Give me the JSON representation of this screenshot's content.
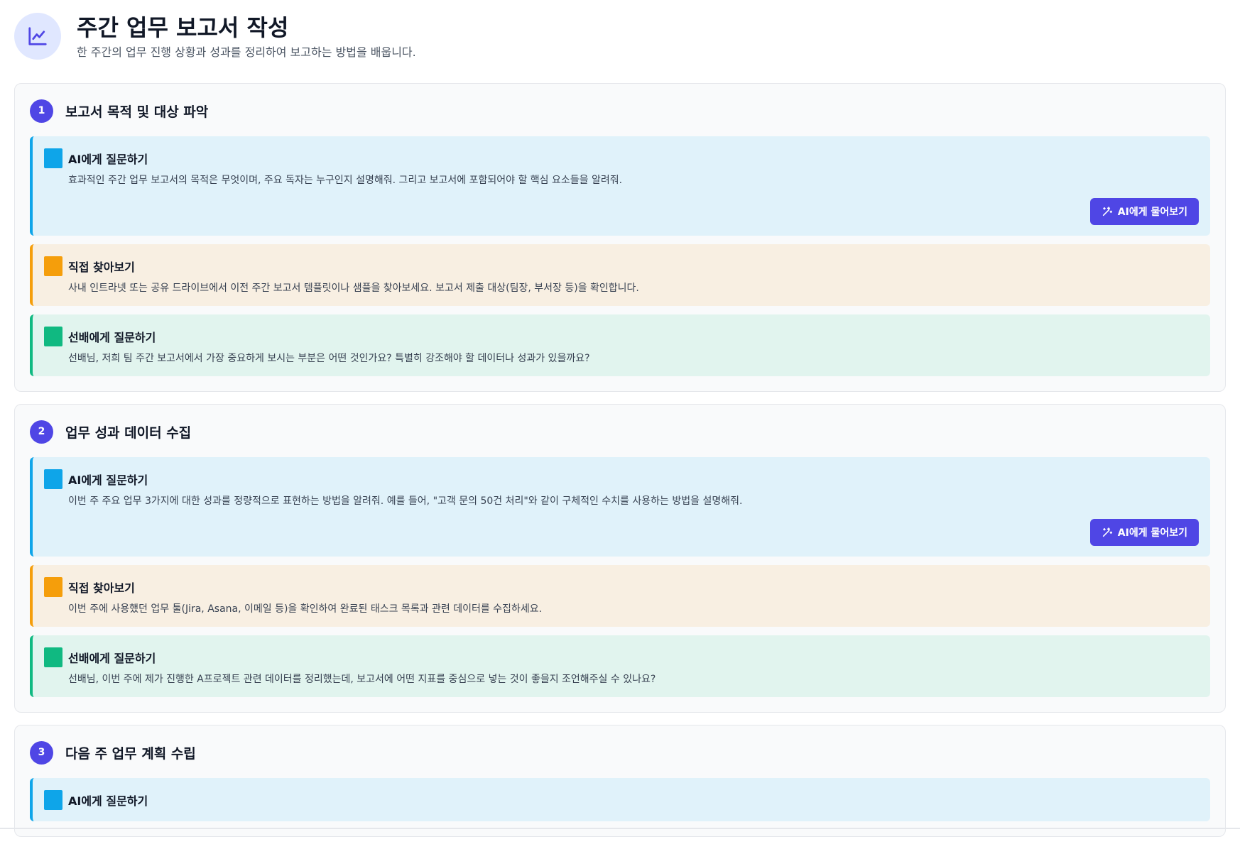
{
  "header": {
    "icon": "chart-line-icon",
    "title": "주간 업무 보고서 작성",
    "subtitle": "한 주간의 업무 진행 상황과 성과를 정리하여 보고하는 방법을 배웁니다."
  },
  "colors": {
    "accent": "#4f46e5",
    "ai": "#0ea5e9",
    "self": "#f59e0b",
    "senior": "#10b981"
  },
  "steps": [
    {
      "number": "1",
      "title": "보고서 목적 및 대상 파악",
      "ai": {
        "title": "AI에게 질문하기",
        "text": "효과적인 주간 업무 보고서의 목적은 무엇이며, 주요 독자는 누구인지 설명해줘. 그리고 보고서에 포함되어야 할 핵심 요소들을 알려줘.",
        "button": "AI에게 물어보기"
      },
      "self": {
        "title": "직접 찾아보기",
        "text": "사내 인트라넷 또는 공유 드라이브에서 이전 주간 보고서 템플릿이나 샘플을 찾아보세요. 보고서 제출 대상(팀장, 부서장 등)을 확인합니다."
      },
      "senior": {
        "title": "선배에게 질문하기",
        "text": "선배님, 저희 팀 주간 보고서에서 가장 중요하게 보시는 부분은 어떤 것인가요? 특별히 강조해야 할 데이터나 성과가 있을까요?"
      }
    },
    {
      "number": "2",
      "title": "업무 성과 데이터 수집",
      "ai": {
        "title": "AI에게 질문하기",
        "text": "이번 주 주요 업무 3가지에 대한 성과를 정량적으로 표현하는 방법을 알려줘. 예를 들어, \"고객 문의 50건 처리\"와 같이 구체적인 수치를 사용하는 방법을 설명해줘.",
        "button": "AI에게 물어보기"
      },
      "self": {
        "title": "직접 찾아보기",
        "text": "이번 주에 사용했던 업무 툴(Jira, Asana, 이메일 등)을 확인하여 완료된 태스크 목록과 관련 데이터를 수집하세요."
      },
      "senior": {
        "title": "선배에게 질문하기",
        "text": "선배님, 이번 주에 제가 진행한 A프로젝트 관련 데이터를 정리했는데, 보고서에 어떤 지표를 중심으로 넣는 것이 좋을지 조언해주실 수 있나요?"
      }
    },
    {
      "number": "3",
      "title": "다음 주 업무 계획 수립",
      "ai": {
        "title": "AI에게 질문하기"
      }
    }
  ]
}
